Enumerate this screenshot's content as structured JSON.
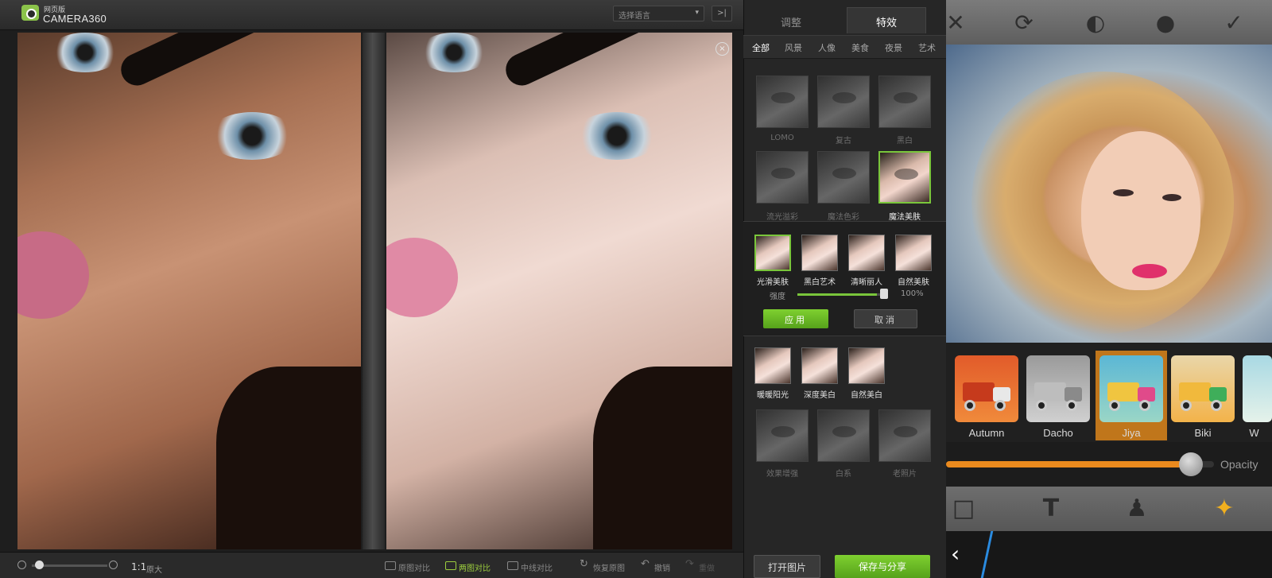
{
  "app": {
    "logo_small": "网页版",
    "logo_main": "CAMERA360",
    "language_select": "选择语言",
    "collapse_symbol": ">|",
    "close_symbol": "×"
  },
  "bottom_bar": {
    "zoom_level": "1:1",
    "zoom_label": "原大",
    "compare_single": "原图对比",
    "compare_split": "两图对比",
    "compare_slider": "中线对比",
    "restore": "恢复原图",
    "undo": "撤销",
    "redo": "重做"
  },
  "panel": {
    "tabs": [
      "调整",
      "特效"
    ],
    "categories": [
      "全部",
      "风景",
      "人像",
      "美食",
      "夜景",
      "艺术"
    ],
    "row1": [
      "LOMO",
      "复古",
      "黑白"
    ],
    "row2": [
      "流光溢彩",
      "魔法色彩",
      "魔法美肤"
    ],
    "sub_filters_1": [
      "光滑美肤",
      "黑白艺术",
      "清晰丽人",
      "自然美肤"
    ],
    "strength_label": "强度",
    "strength_value": "100%",
    "strength": 1.0,
    "apply": "应用",
    "cancel": "取消",
    "sub_filters_2": [
      "暖暖阳光",
      "深度美白",
      "自然美白"
    ],
    "row3": [
      "效果增强",
      "白系",
      "老照片"
    ],
    "open_image": "打开图片",
    "save_share": "保存与分享"
  },
  "phone": {
    "top_icons": [
      "close-icon",
      "rotate-icon",
      "contrast-icon",
      "drop-icon",
      "check-icon"
    ],
    "top_glyphs": [
      "✕",
      "⟳",
      "◐",
      "●",
      "✓"
    ],
    "filters": [
      "Autumn",
      "Dacho",
      "Jiya",
      "Biki",
      "W"
    ],
    "selected_filter": "Jiya",
    "opacity_label": "Opacity",
    "opacity": 0.93,
    "tool_glyphs": [
      "□",
      "T",
      "♟",
      "✦"
    ],
    "back_glyph": "‹"
  },
  "colors": {
    "accent_green": "#7ac63b",
    "phone_accent_orange": "#ea8a1e"
  }
}
